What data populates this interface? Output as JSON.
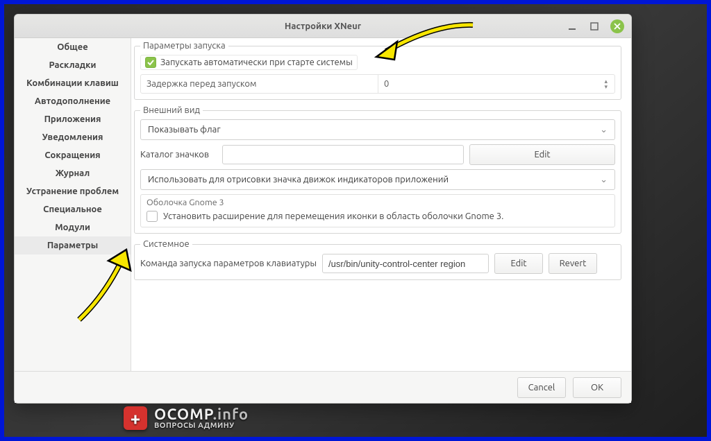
{
  "window": {
    "title": "Настройки XNeur"
  },
  "sidebar": {
    "items": [
      "Общее",
      "Раскладки",
      "Комбинации клавиш",
      "Автодополнение",
      "Приложения",
      "Уведомления",
      "Сокращения",
      "Журнал",
      "Устранение проблем",
      "Специальное",
      "Модули",
      "Параметры"
    ],
    "selected": 11
  },
  "startup": {
    "legend": "Параметры запуска",
    "autostart_label": "Запускать автоматически при старте системы",
    "autostart_checked": true,
    "delay_label": "Задержка перед запуском",
    "delay_value": "0"
  },
  "appearance": {
    "legend": "Внешний вид",
    "show_flag_select": "Показывать флаг",
    "icon_folder_label": "Каталог значков",
    "icon_folder_value": "",
    "edit_button": "Edit",
    "render_engine_select": "Использовать для отрисовки значка движок индикаторов приложений",
    "gnome3": {
      "title": "Оболочка Gnome 3",
      "checkbox_label": "Установить расширение для перемещения иконки в область оболочки Gnome 3.",
      "checked": false
    }
  },
  "system": {
    "legend": "Системное",
    "keyboard_cmd_label": "Команда запуска параметров клавиатуры",
    "keyboard_cmd_value": "/usr/bin/unity-control-center region",
    "edit_button": "Edit",
    "revert_button": "Revert"
  },
  "footer": {
    "cancel": "Cancel",
    "ok": "OK"
  },
  "watermark": {
    "brand": "OCOMP",
    "tld": ".info",
    "tagline": "ВОПРОСЫ АДМИНУ"
  }
}
